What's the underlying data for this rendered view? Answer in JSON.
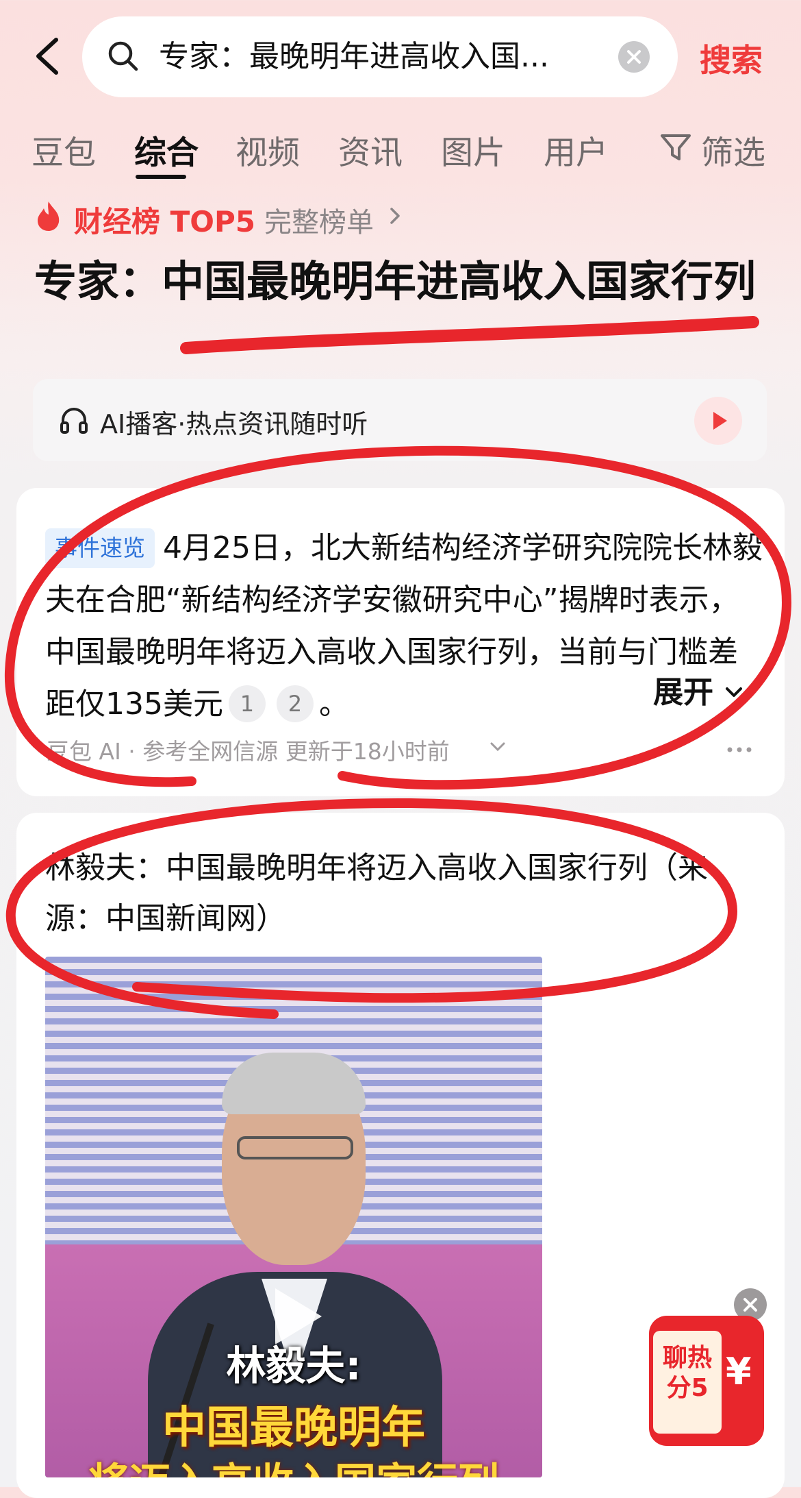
{
  "header": {
    "search_query": "专家：最晚明年进高收入国...",
    "search_button": "搜索"
  },
  "tabs": [
    "豆包",
    "综合",
    "视频",
    "资讯",
    "图片",
    "用户",
    "筛选"
  ],
  "active_tab": "综合",
  "rank": {
    "label": "财经榜 TOP5",
    "link": "完整榜单"
  },
  "headline": "专家：中国最晚明年进高收入国家行列",
  "podcast": {
    "text": "AI播客·热点资讯随时听"
  },
  "summary": {
    "badge": "事件速览",
    "text": "4月25日，北大新结构经济学研究院院长林毅夫在合肥“新结构经济学安徽研究中心”揭牌时表示，中国最晚明年将迈入高收入国家行列，当前与门槛差距仅135美元",
    "cite1": "1",
    "cite2": "2",
    "end": "。",
    "expand": "展开",
    "meta": "豆包 AI · 参考全网信源  更新于18小时前"
  },
  "news": {
    "title": "林毅夫：中国最晚明年将迈入高收入国家行列（来源：中国新闻网）",
    "video_caption_1": "林毅夫:",
    "video_caption_2": "中国最晚明年",
    "video_caption_3": "将迈入高收入国家行列"
  },
  "promo": {
    "line1": "聊热",
    "line2": "分5",
    "currency": "¥"
  },
  "colors": {
    "accent": "#ef3b3b",
    "badge_blue": "#2f73d9",
    "annotation_red": "#e8262c"
  }
}
